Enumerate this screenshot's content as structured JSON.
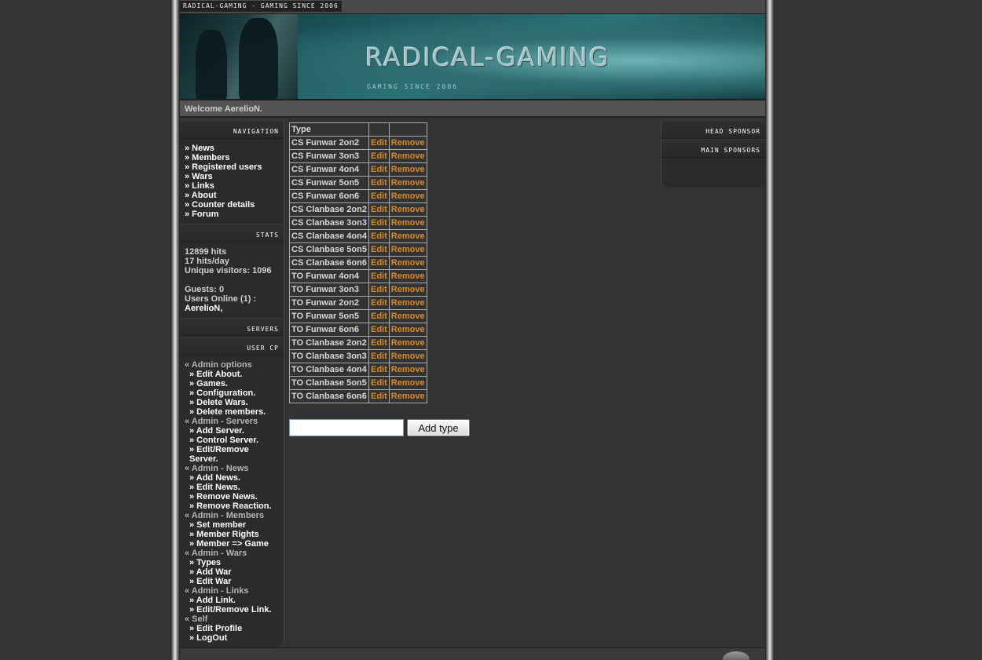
{
  "topbar": {
    "title": "Radical-Gaming - Gaming since 2006"
  },
  "banner": {
    "title": "RADICAL-GAMING",
    "subtitle": "Gaming since 2006"
  },
  "welcome": "Welcome AerelioN.",
  "sidebar": {
    "navigation_header": "Navigation",
    "nav_items": [
      "» News",
      "» Members",
      "» Registered users",
      "» Wars",
      "» Links",
      "» About",
      "» Counter details",
      "» Forum"
    ],
    "stats_header": "Stats",
    "stats": {
      "hits": "12899 hits",
      "hits_per_day": "17 hits/day",
      "unique": "Unique visitors: 1096",
      "guests": "Guests: 0",
      "users_online": "Users Online (1) :",
      "online_user": "AerelioN,"
    },
    "servers_header": "Servers",
    "usercp_header": "User CP",
    "usercp": [
      {
        "label": "« Admin options",
        "type": "group"
      },
      {
        "label": "» Edit About.",
        "type": "item"
      },
      {
        "label": "» Games.",
        "type": "item"
      },
      {
        "label": "» Configuration.",
        "type": "item"
      },
      {
        "label": "» Delete Wars.",
        "type": "item"
      },
      {
        "label": "» Delete members.",
        "type": "item"
      },
      {
        "label": "« Admin - Servers",
        "type": "group"
      },
      {
        "label": "» Add Server.",
        "type": "item"
      },
      {
        "label": "» Control Server.",
        "type": "item"
      },
      {
        "label": "» Edit/Remove Server.",
        "type": "item"
      },
      {
        "label": "« Admin - News",
        "type": "group"
      },
      {
        "label": "» Add News.",
        "type": "item"
      },
      {
        "label": "» Edit News.",
        "type": "item"
      },
      {
        "label": "» Remove News.",
        "type": "item"
      },
      {
        "label": "» Remove Reaction.",
        "type": "item"
      },
      {
        "label": "« Admin - Members",
        "type": "group"
      },
      {
        "label": "» Set member",
        "type": "item"
      },
      {
        "label": "» Member Rights",
        "type": "item"
      },
      {
        "label": "» Member => Game",
        "type": "item"
      },
      {
        "label": "« Admin - Wars",
        "type": "group"
      },
      {
        "label": "» Types",
        "type": "item"
      },
      {
        "label": "» Add War",
        "type": "item"
      },
      {
        "label": "» Edit War",
        "type": "item"
      },
      {
        "label": "« Admin - Links",
        "type": "group"
      },
      {
        "label": "» Add Link.",
        "type": "item"
      },
      {
        "label": "» Edit/Remove Link.",
        "type": "item"
      },
      {
        "label": "« Self",
        "type": "group"
      },
      {
        "label": "» Edit Profile",
        "type": "item"
      },
      {
        "label": "» LogOut",
        "type": "item"
      }
    ]
  },
  "main": {
    "table_header": "Type",
    "edit_label": "Edit",
    "remove_label": "Remove",
    "types": [
      "CS Funwar 2on2",
      "CS Funwar 3on3",
      "CS Funwar 4on4",
      "CS Funwar 5on5",
      "CS Funwar 6on6",
      "CS Clanbase 2on2",
      "CS Clanbase 3on3",
      "CS Clanbase 4on4",
      "CS Clanbase 5on5",
      "CS Clanbase 6on6",
      "TO Funwar 4on4",
      "TO Funwar 3on3",
      "TO Funwar 2on2",
      "TO Funwar 5on5",
      "TO Funwar 6on6",
      "TO Clanbase 2on2",
      "TO Clanbase 3on3",
      "TO Clanbase 4on4",
      "TO Clanbase 5on5",
      "TO Clanbase 6on6"
    ],
    "add_input_value": "",
    "add_button": "Add type"
  },
  "rightbar": {
    "head_sponsor": "Head sponsor",
    "main_sponsors": "Main sponsors"
  },
  "colors": {
    "accent": "#d98a2a",
    "background": "#353535",
    "banner_teal": "#2c7176"
  }
}
